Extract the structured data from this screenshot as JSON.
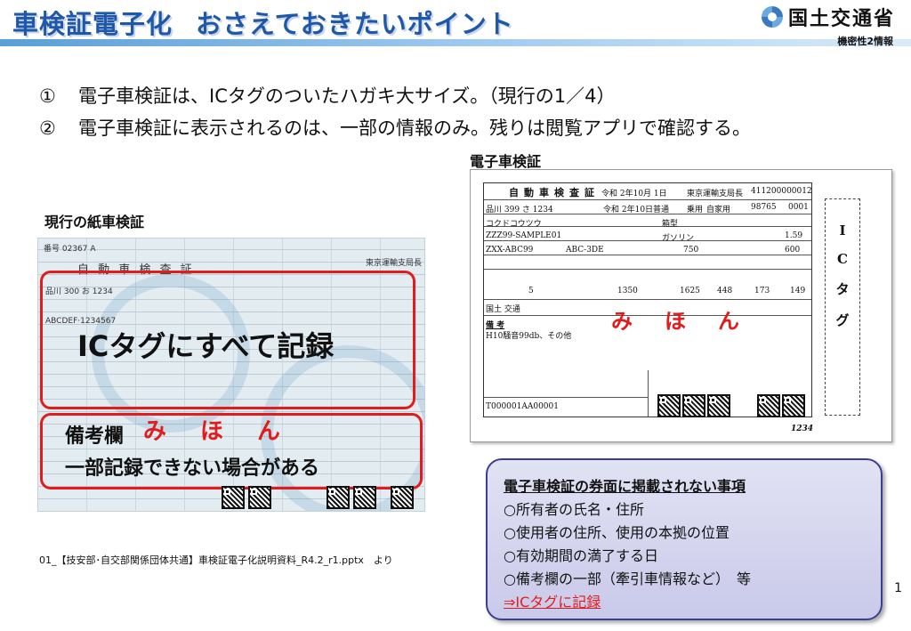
{
  "header": {
    "title_main": "車検証電子化",
    "title_sub": "おさえておきたいポイント",
    "logo_text": "国土交通省",
    "confidentiality": "機密性2情報"
  },
  "points": [
    {
      "num": "①",
      "text": "電子車検証は、ICタグのついたハガキ大サイズ。（現行の1／4）"
    },
    {
      "num": "②",
      "text": "電子車検証に表示されるのは、一部の情報のみ。残りは閲覧アプリで確認する。"
    }
  ],
  "paper_cert": {
    "label": "現行の紙車検証",
    "doc_title": "自 動 車 検 査 証",
    "cert_no": "番号 02367 A",
    "bureau": "東京運輸支局長",
    "plate": "品川 300 お 1234",
    "vin": "ABCDEF·1234567",
    "overlay_ic": "ICタグにすべて記録",
    "overlay_remarks_label": "備考欄",
    "overlay_remarks": "一部記録できない場合がある",
    "mihon": "みほん"
  },
  "e_cert": {
    "label": "電子車検証",
    "doc_title": "自動車検査証",
    "date": "令和 2年10月 1日",
    "bureau": "東京運輸支局長",
    "cert_code": "411200000012",
    "plate": "品川 399 さ 1234",
    "reg_date": "令和 2年10日",
    "use": "普通",
    "type": "乗用",
    "purpose": "自家用",
    "model_code": "98765",
    "seq": "0001",
    "maker": "コクドコウツウ",
    "body": "箱型",
    "chassis": "ZZZ99-SAMPLE01",
    "fuel": "ガソリン",
    "fuel_eff": "1.59",
    "model": "ZXX-ABC99",
    "engine": "ABC-3DE",
    "cap1": "750",
    "cap2": "600",
    "capacity": "5",
    "weight": "1350",
    "gross": "1625",
    "len": "448",
    "wid": "173",
    "hgt": "149",
    "owner": "国土 交通",
    "remarks_label": "備 考",
    "remarks": "H10騒音99db、その他",
    "footer_code": "T000001AA00001",
    "footer_num": "1234",
    "mihon": "みほん",
    "ic_tag_label": [
      "I",
      "C",
      "タ",
      "グ"
    ]
  },
  "info_box": {
    "heading": "電子車検証の券面に掲載されない事項",
    "items": [
      "○所有者の氏名・住所",
      "○使用者の住所、使用の本拠の位置",
      "○有効期間の満了する日",
      "○備考欄の一部（牽引車情報など）　等"
    ],
    "conclusion": "⇒ICタグに記録"
  },
  "source_note": "01_【技安部･自交部関係団体共通】車検証電子化説明資料_R4.2_r1.pptx　より",
  "page_number": "1",
  "colors": {
    "title": "#1f58a8",
    "accent_red": "#e31b1b",
    "box_border": "#3b3f8f"
  }
}
